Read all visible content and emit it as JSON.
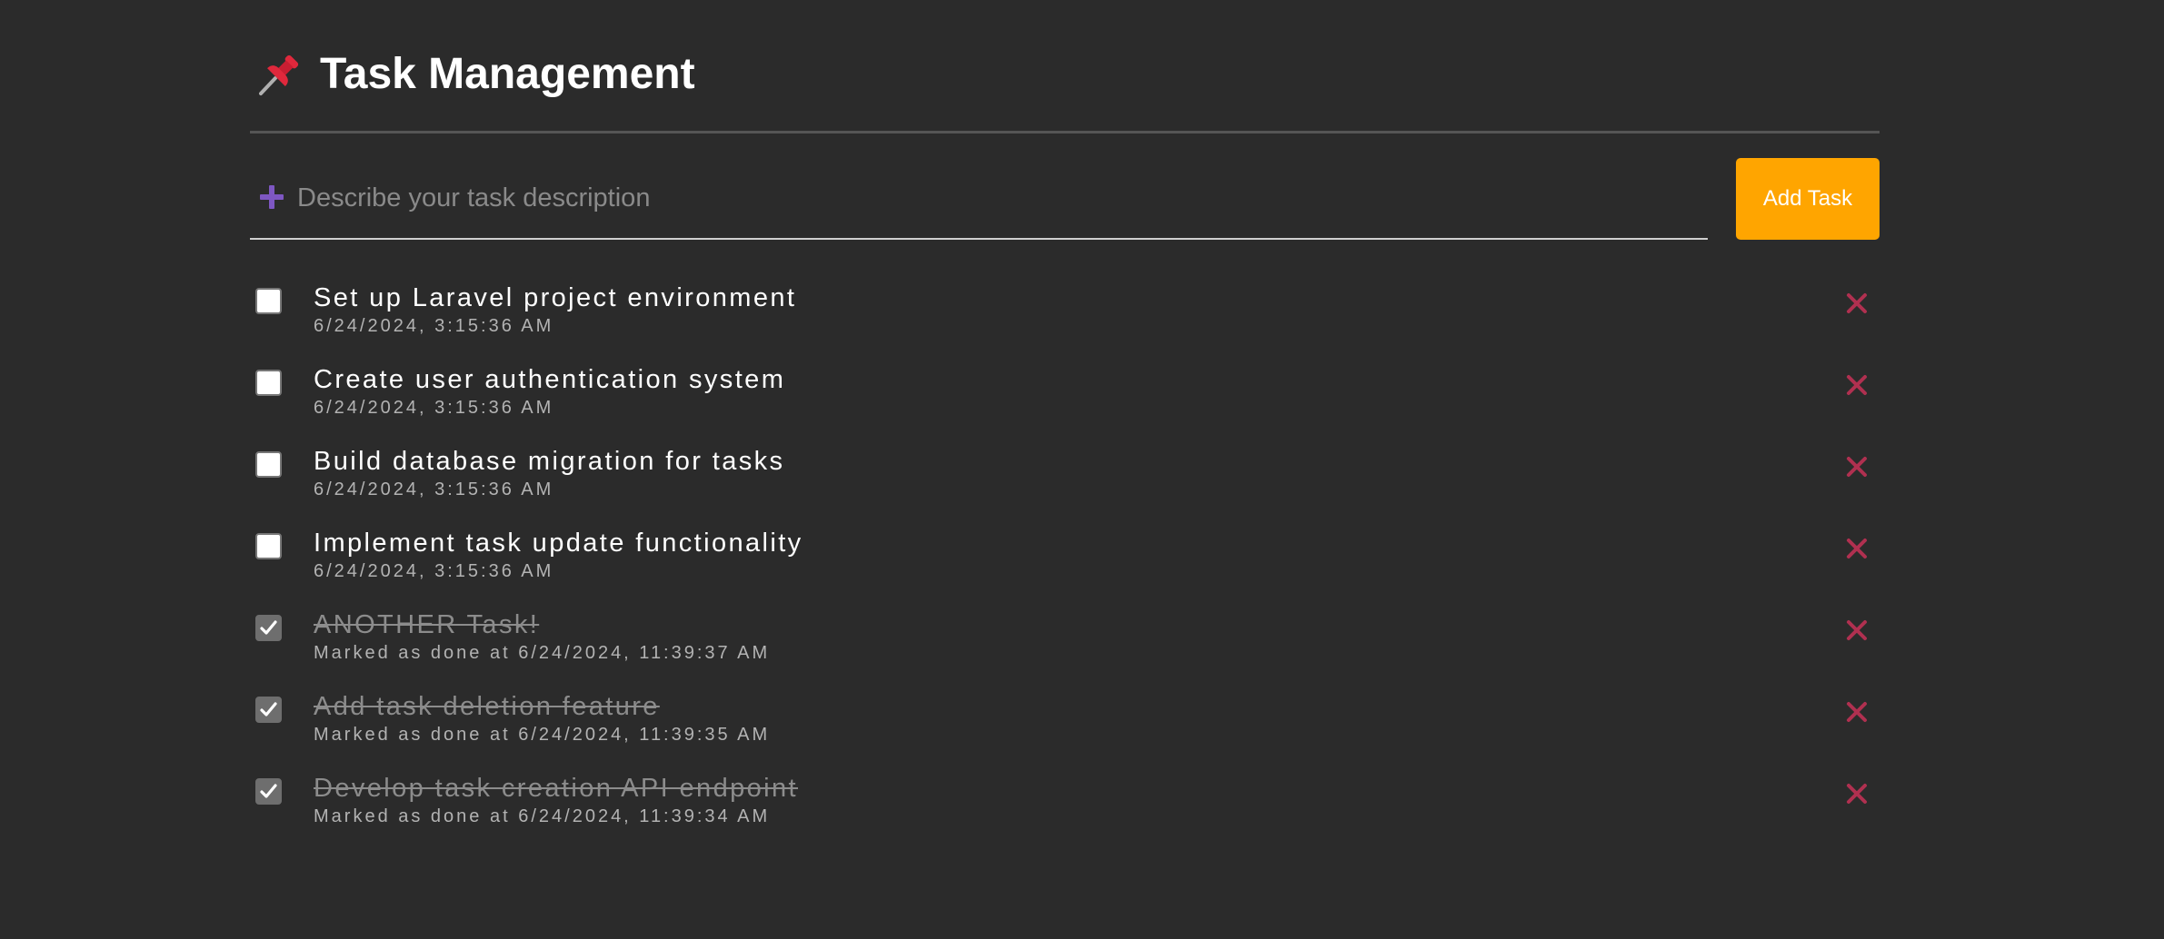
{
  "header": {
    "title": "Task Management",
    "icon": "pushpin-icon"
  },
  "add_form": {
    "placeholder": "Describe your task description",
    "value": "",
    "button_label": "Add Task",
    "button_color": "#ffa500",
    "plus_icon_color": "#7e57c2"
  },
  "tasks": [
    {
      "title": "Set up Laravel project environment",
      "subtitle": "6/24/2024, 3:15:36 AM",
      "done": false
    },
    {
      "title": "Create user authentication system",
      "subtitle": "6/24/2024, 3:15:36 AM",
      "done": false
    },
    {
      "title": "Build database migration for tasks",
      "subtitle": "6/24/2024, 3:15:36 AM",
      "done": false
    },
    {
      "title": "Implement task update functionality",
      "subtitle": "6/24/2024, 3:15:36 AM",
      "done": false
    },
    {
      "title": "ANOTHER Task!",
      "subtitle": "Marked as done at 6/24/2024, 11:39:37 AM",
      "done": true
    },
    {
      "title": "Add task deletion feature",
      "subtitle": "Marked as done at 6/24/2024, 11:39:35 AM",
      "done": true
    },
    {
      "title": "Develop task creation API endpoint",
      "subtitle": "Marked as done at 6/24/2024, 11:39:34 AM",
      "done": true
    }
  ],
  "colors": {
    "background": "#2b2b2b",
    "delete_icon": "#b03050"
  }
}
